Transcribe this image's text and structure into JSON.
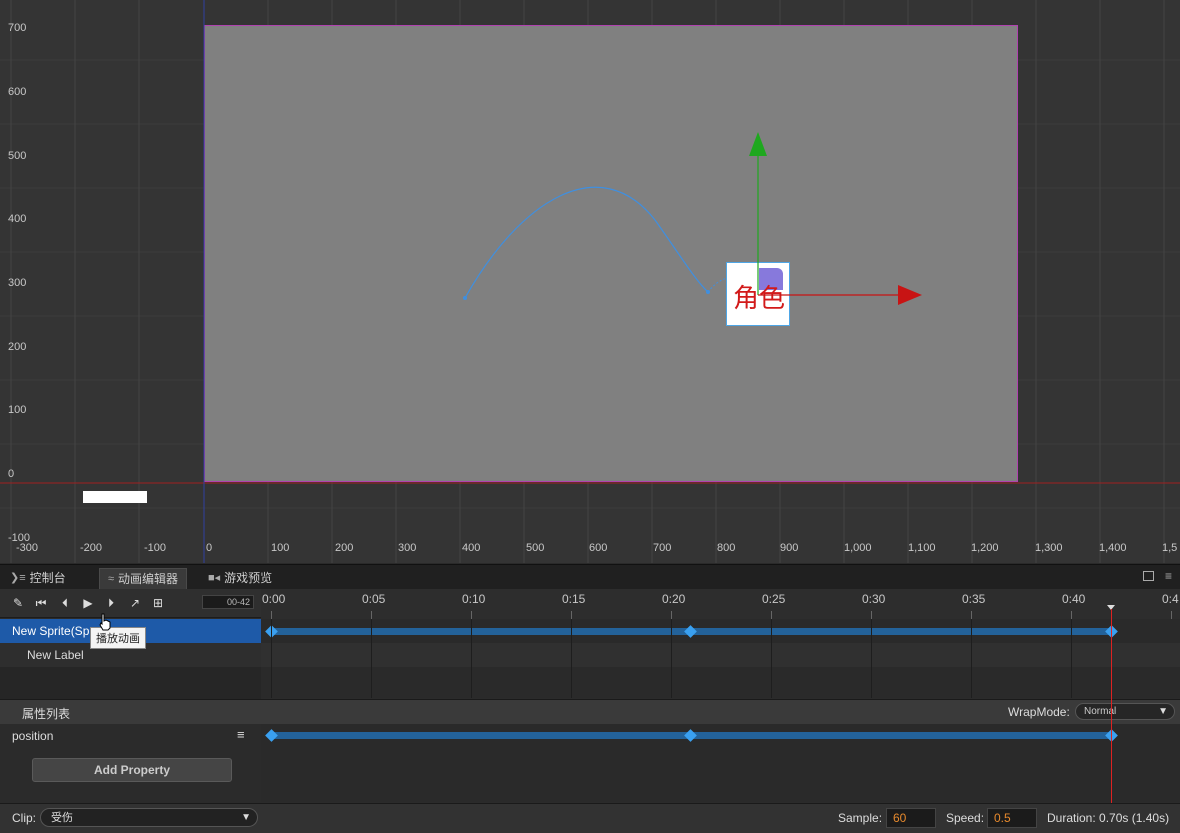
{
  "scene": {
    "y_labels": [
      "700",
      "600",
      "500",
      "400",
      "300",
      "200",
      "100",
      "0",
      "-100"
    ],
    "x_labels": [
      "-300",
      "-200",
      "-100",
      "0",
      "100",
      "200",
      "300",
      "400",
      "500",
      "600",
      "700",
      "800",
      "900",
      "1,000",
      "1,100",
      "1,200",
      "1,300",
      "1,400",
      "1,5"
    ],
    "node_text": "角色",
    "colors": {
      "design_border": "#b042b0",
      "axis_y": "#1fa81f",
      "axis_x": "#c81414",
      "path": "#3f8fe0"
    }
  },
  "tabs": [
    {
      "label": "控制台",
      "icon": "console-icon"
    },
    {
      "label": "动画编辑器",
      "icon": "animation-icon"
    },
    {
      "label": "游戏预览",
      "icon": "camera-icon"
    }
  ],
  "toolbar": {
    "frame_value": "00-42"
  },
  "ruler": {
    "labels": [
      "0:00",
      "0:05",
      "0:10",
      "0:15",
      "0:20",
      "0:25",
      "0:30",
      "0:35",
      "0:40",
      "0:4"
    ]
  },
  "nodes": [
    {
      "label": "New Sprite(Sp"
    },
    {
      "label": "New Label"
    }
  ],
  "tooltip": "播放动画",
  "properties": {
    "title": "属性列表",
    "wrap_label": "WrapMode:",
    "wrap_value": "Normal",
    "items": [
      {
        "label": "position"
      }
    ],
    "add_button": "Add Property"
  },
  "footer": {
    "clip_label": "Clip:",
    "clip_value": "受伤",
    "sample_label": "Sample:",
    "sample_value": "60",
    "speed_label": "Speed:",
    "speed_value": "0.5",
    "duration": "Duration: 0.70s (1.40s)"
  }
}
